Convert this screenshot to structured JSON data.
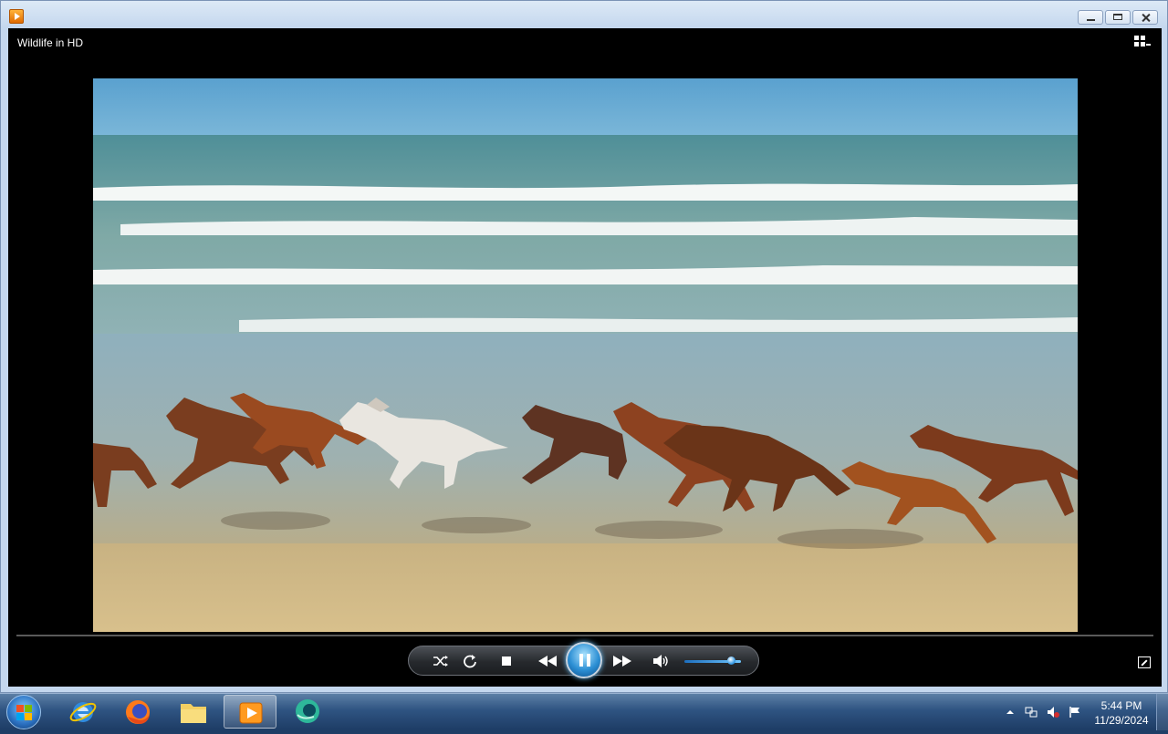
{
  "window": {
    "app_icon": "media-player-icon",
    "caption_buttons": [
      "minimize-icon",
      "restore-icon",
      "close-icon"
    ]
  },
  "player": {
    "media_title": "Wildlife in HD",
    "switch_to_library_icon": "switch-to-library-icon",
    "controls": {
      "icons": [
        "shuffle-icon",
        "repeat-icon",
        "stop-icon",
        "previous-icon",
        "pause-icon",
        "next-icon",
        "volume-icon"
      ],
      "volume_level": 0.9
    },
    "fullscreen_icon": "fullscreen-icon"
  },
  "taskbar": {
    "start_icon": "windows-start-icon",
    "pinned": [
      {
        "name": "internet-explorer",
        "icon": "internet-explorer-icon"
      },
      {
        "name": "firefox",
        "icon": "firefox-icon"
      },
      {
        "name": "windows-explorer",
        "icon": "folder-icon"
      },
      {
        "name": "windows-media-player",
        "icon": "media-player-icon",
        "active": true
      },
      {
        "name": "screen-app",
        "icon": "globe-icon"
      }
    ],
    "tray_icons": [
      "show-hidden-icons-icon",
      "network-icon",
      "speaker-muted-icon",
      "action-center-flag-icon"
    ],
    "clock": {
      "time": "5:44 PM",
      "date": "11/29/2024"
    }
  },
  "colors": {
    "taskbar": "#2f5482",
    "player_background": "#000000",
    "play_button": "#2c8fd4",
    "volume_accent": "#3c9fe8"
  }
}
